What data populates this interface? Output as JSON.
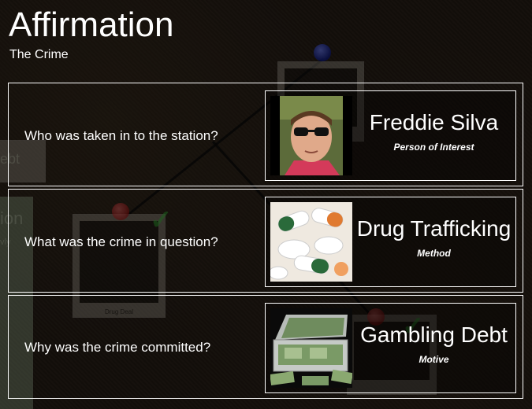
{
  "header": {
    "title": "Affirmation",
    "subtitle": "The Crime"
  },
  "background": {
    "fragments": [
      "ebt",
      "ion",
      "vly"
    ],
    "card_caption": "Drug Deal",
    "check_mark": "✓"
  },
  "rows": [
    {
      "question": "Who was taken in to the station?",
      "answer": "Freddie Silva",
      "role": "Person of Interest",
      "image_icon": "suspect-photo"
    },
    {
      "question": "What was the crime in question?",
      "answer": "Drug Trafficking",
      "role": "Method",
      "image_icon": "pills-photo"
    },
    {
      "question": "Why was the crime committed?",
      "answer": "Gambling Debt",
      "role": "Motive",
      "image_icon": "money-case-photo"
    }
  ]
}
